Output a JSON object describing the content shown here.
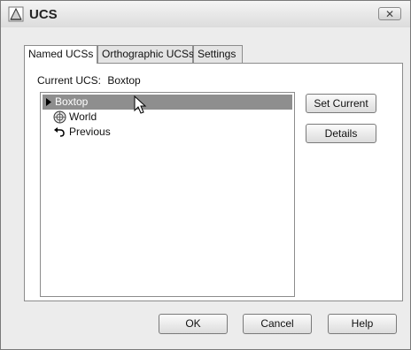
{
  "window": {
    "title": "UCS",
    "close_glyph": "✕"
  },
  "tabs": [
    {
      "label": "Named UCSs",
      "active": true
    },
    {
      "label": "Orthographic UCSs",
      "active": false
    },
    {
      "label": "Settings",
      "active": false
    }
  ],
  "current_ucs": {
    "label": "Current UCS:",
    "value": "Boxtop"
  },
  "ucs_list": {
    "items": [
      {
        "label": "Boxtop",
        "icon": "current-marker-arrow",
        "selected": true
      },
      {
        "label": "World",
        "icon": "world-globe-icon",
        "selected": false
      },
      {
        "label": "Previous",
        "icon": "previous-undo-arrow-icon",
        "selected": false
      }
    ]
  },
  "side_buttons": {
    "set_current": "Set Current",
    "details": "Details"
  },
  "footer_buttons": {
    "ok": "OK",
    "cancel": "Cancel",
    "help": "Help"
  }
}
